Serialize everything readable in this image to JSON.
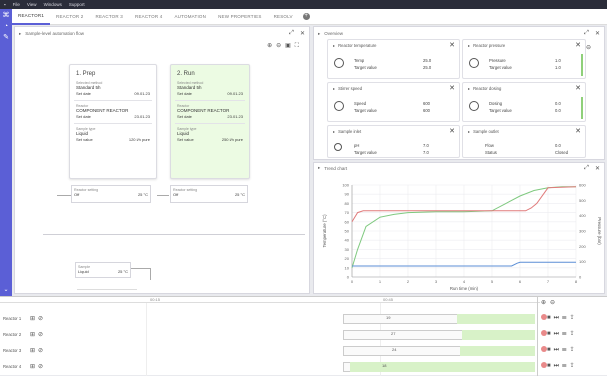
{
  "titlebar": {
    "items": [
      "File",
      "View",
      "Windows",
      "Support"
    ]
  },
  "tabs": [
    {
      "label": "REACTOR1",
      "active": true
    },
    {
      "label": "REACTOR 2",
      "active": false
    },
    {
      "label": "REACTOR 3",
      "active": false
    },
    {
      "label": "REACTOR 4",
      "active": false
    },
    {
      "label": "AUTOMATION",
      "active": false
    },
    {
      "label": "NEW PROPERTIES",
      "active": false
    },
    {
      "label": "RESOLV",
      "active": false
    }
  ],
  "left_panel": {
    "title": "Sample-level automation flow"
  },
  "cards": [
    {
      "title": "1. Prep",
      "l1": "Selected method",
      "v1": "Standard 5h",
      "k1": "Set date",
      "kv1": "09.01.23",
      "l2": "Reactor",
      "v2": "COMPONENT REACTOR",
      "k2": "Set date",
      "kv2": "23.01.23",
      "l3": "Sample type",
      "v3": "Liquid",
      "k3": "Set value",
      "kv3": "120 l/h pure"
    },
    {
      "title": "2. Run",
      "l1": "Selected method",
      "v1": "Standard 5h",
      "k1": "Set date",
      "kv1": "09.01.23",
      "l2": "Reactor",
      "v2": "COMPONENT REACTOR",
      "k2": "Set date",
      "kv2": "23.01.23",
      "l3": "Sample type",
      "v3": "Liquid",
      "k3": "Set value",
      "kv3": "250 l/h pure"
    }
  ],
  "subnodes": [
    {
      "label": "Reactor setting",
      "value": "Off",
      "v2": "25 °C"
    },
    {
      "label": "Reactor setting",
      "value": "Off",
      "v2": "25 °C"
    }
  ],
  "lower_node": {
    "label": "Sample",
    "value": "Liquid",
    "v2": "25 °C"
  },
  "right_panel": {
    "title": "Overview"
  },
  "minis": [
    {
      "title": "Reactor temperature",
      "r1": "Temp",
      "r1v": "25.0",
      "r2": "Target value",
      "r2v": "25.0"
    },
    {
      "title": "Reactor pressure",
      "r1": "Pressure",
      "r1v": "1.0",
      "r2": "Target value",
      "r2v": "1.0"
    },
    {
      "title": "Stirrer speed",
      "r1": "Speed",
      "r1v": "600",
      "r2": "Target value",
      "r2v": "600"
    },
    {
      "title": "Reactor dosing",
      "r1": "Dosing",
      "r1v": "0.0",
      "r2": "Target value",
      "r2v": "0.0"
    },
    {
      "title": "Sample inlet",
      "r1": "pH",
      "r1v": "7.0",
      "r2": "Target value",
      "r2v": "7.0"
    },
    {
      "title": "Sample outlet",
      "r1": "Flow",
      "r1v": "0.0",
      "r2": "Status",
      "r2v": "Closed"
    }
  ],
  "chart_panel": {
    "title": "Trend chart"
  },
  "chart_data": {
    "type": "line",
    "xlabel": "Run time (min)",
    "ylabel": "Temperature (°C)",
    "y2label": "Pressure (bar)",
    "x_ticks": [
      "0",
      "1",
      "2",
      "3",
      "4",
      "5",
      "6",
      "7",
      "8"
    ],
    "y_ticks": [
      "0",
      "10",
      "20",
      "30",
      "40",
      "50",
      "60",
      "70",
      "80",
      "90",
      "100"
    ],
    "y2_ticks": [
      "0",
      "100",
      "200",
      "300",
      "400",
      "500",
      "600"
    ],
    "xlim": [
      0,
      8
    ],
    "ylim": [
      0,
      100
    ],
    "series": [
      {
        "color": "#7fc97f",
        "x": [
          0,
          0.2,
          0.5,
          1,
          1.5,
          2,
          3,
          4,
          5,
          5.5,
          6,
          6.5,
          7,
          7.5,
          8
        ],
        "y": [
          10,
          30,
          55,
          65,
          68,
          70,
          71,
          71,
          72,
          80,
          88,
          94,
          97,
          98,
          98
        ]
      },
      {
        "color": "#e07b7b",
        "x": [
          0,
          0.2,
          0.4,
          1,
          1.2,
          2,
          4,
          5.6,
          5.8,
          6,
          6.2,
          6.4,
          6.6,
          7,
          8
        ],
        "y": [
          60,
          70,
          72,
          72,
          72,
          72,
          72,
          72,
          72,
          72,
          72,
          75,
          80,
          97,
          98
        ]
      },
      {
        "color": "#5b8ed6",
        "x": [
          0,
          4,
          5,
          5.7,
          5.9,
          6,
          7,
          8
        ],
        "y": [
          12,
          12,
          12,
          12,
          15,
          16,
          16,
          16
        ]
      }
    ]
  },
  "tracks": [
    {
      "label": "Reactor 1",
      "marker": "19"
    },
    {
      "label": "Reactor 2",
      "marker": "27"
    },
    {
      "label": "Reactor 3",
      "marker": "24"
    },
    {
      "label": "Reactor 4",
      "marker": "18"
    }
  ],
  "timeline": {
    "t1": "00:15",
    "t2": "00:45"
  }
}
